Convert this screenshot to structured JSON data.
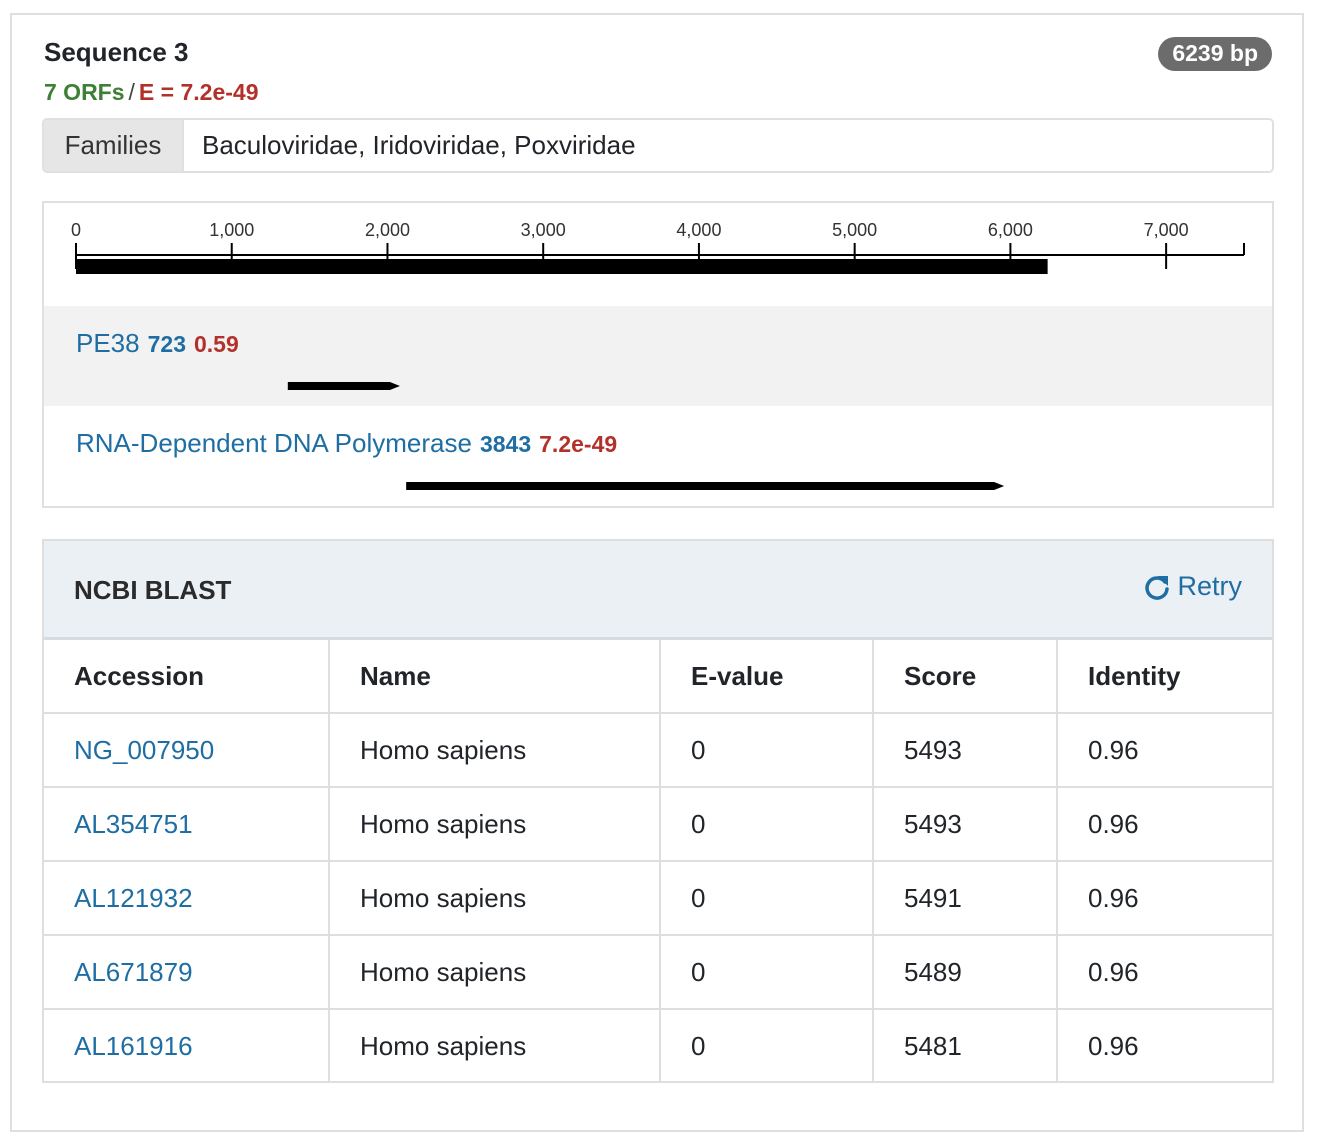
{
  "sequence": {
    "title": "Sequence 3",
    "orf_count": "7 ORFs",
    "separator": "/",
    "evalue": "E = 7.2e-49",
    "length_badge": "6239 bp"
  },
  "families": {
    "label": "Families",
    "value": "Baculoviridae, Iridoviridae, Poxviridae"
  },
  "sequence_map": {
    "axis_max": 7500,
    "tick_values": [
      0,
      1000,
      2000,
      3000,
      4000,
      5000,
      6000,
      7000
    ],
    "tick_labels": [
      "0",
      "1,000",
      "2,000",
      "3,000",
      "4,000",
      "5,000",
      "6,000",
      "7,000"
    ],
    "sequence_length": 6239,
    "orfs": [
      {
        "name": "PE38",
        "length": "723",
        "evalue": "0.59",
        "start": 1360,
        "end": 2080
      },
      {
        "name": "RNA-Dependent DNA Polymerase",
        "length": "3843",
        "evalue": "7.2e-49",
        "start": 2120,
        "end": 5960
      }
    ]
  },
  "blast": {
    "title": "NCBI BLAST",
    "retry_label": "Retry",
    "columns": [
      "Accession",
      "Name",
      "E-value",
      "Score",
      "Identity"
    ],
    "rows": [
      [
        "NG_007950",
        "Homo sapiens",
        "0",
        "5493",
        "0.96"
      ],
      [
        "AL354751",
        "Homo sapiens",
        "0",
        "5493",
        "0.96"
      ],
      [
        "AL121932",
        "Homo sapiens",
        "0",
        "5491",
        "0.96"
      ],
      [
        "AL671879",
        "Homo sapiens",
        "0",
        "5489",
        "0.96"
      ],
      [
        "AL161916",
        "Homo sapiens",
        "0",
        "5481",
        "0.96"
      ]
    ]
  },
  "colors": {
    "link": "#1f6ea3",
    "orfs_green": "#3d7f35",
    "evalue_red": "#b3312b",
    "badge_gray": "#6c6c6c"
  }
}
